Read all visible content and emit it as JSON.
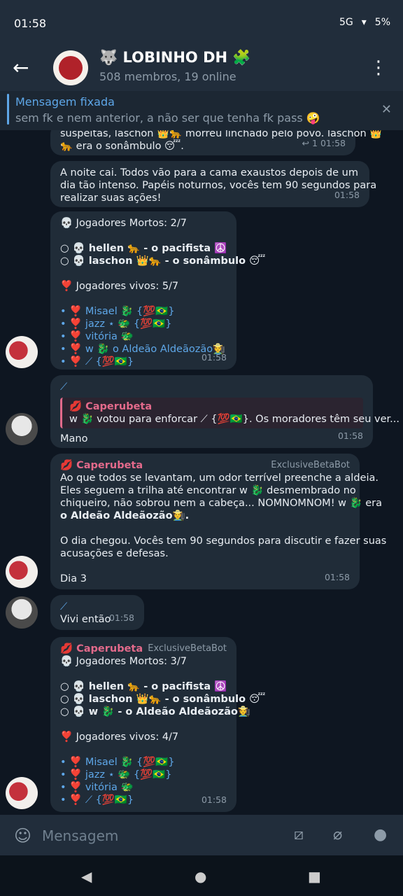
{
  "status": {
    "time": "01:58",
    "battery": "5%",
    "network": "5G"
  },
  "header": {
    "title": "🐺 LOBINHO DH 🧩",
    "subtitle": "508 membros, 19 online"
  },
  "pinned": {
    "label": "Mensagem fixada",
    "text": "sem fk e nem anterior, a não ser que tenha fk pass 🤪"
  },
  "messages": {
    "m1": {
      "l1": "suspeitas, laschon 👑🐆 morreu linchado pelo povo. laschon 👑",
      "l2": "🐆 era o sonâmbulo 😴.",
      "meta": "↩ 1 01:58"
    },
    "m2": {
      "l1": "A noite cai. Todos vão para a cama exaustos depois de um",
      "l2": "dia tão intenso. Papéis noturnos, vocês tem 90 segundos para",
      "l3": "realizar suas ações!",
      "time": "01:58"
    },
    "m3": {
      "h1": "💀 Jogadores Mortos: 2/7",
      "d1": "○ 💀 hellen 🐆 - o pacifista ☮️",
      "d2": "○ 💀 laschon 👑🐆 - o sonâmbulo 😴",
      "h2": "❣️ Jogadores vivos: 5/7",
      "a1": "• ❣️ Misael 🐉 {💯🇧🇷}",
      "a2": "• ❣️ jazz ⋆ 🐲 {💯🇧🇷}",
      "a3": "• ❣️ vitória 🐲",
      "a4": "• ❣️ w 🐉 o Aldeão Aldeãozão🧑‍🌾",
      "a5": "• ❣️ ⟋ {💯🇧🇷}",
      "time": "01:58"
    },
    "m4": {
      "top": "⟋",
      "q_sender": "💋 Caperubeta",
      "q_text": "w 🐉 votou para enforcar ⟋ {💯🇧🇷}.  Os moradores têm seu ver...",
      "text": "Mano",
      "time": "01:58"
    },
    "m5": {
      "sender": "💋 Caperubeta",
      "via": "ExclusiveBetaBot",
      "l1": "Ao que todos se levantam, um odor terrível preenche a aldeia.",
      "l2": "Eles seguem a trilha até encontrar w 🐉 desmembrado no",
      "l3": "chiqueiro, não sobrou nem a cabeça... NOMNOMNOM! w 🐉 era",
      "l4": "o Aldeão Aldeãozão🧑‍🌾.",
      "l5": "O dia chegou. Vocês tem 90 segundos para discutir e fazer suas",
      "l6": "acusações e defesas.",
      "l7": "Dia 3",
      "time": "01:58"
    },
    "m6": {
      "top": "⟋",
      "text": "Vivi então",
      "time": "01:58"
    },
    "m7": {
      "sender": "💋 Caperubeta",
      "via": "ExclusiveBetaBot",
      "h1": "💀 Jogadores Mortos: 3/7",
      "d1": "○ 💀 hellen 🐆 - o pacifista ☮️",
      "d2": "○ 💀 laschon 👑🐆 - o sonâmbulo 😴",
      "d3": "○ 💀 w 🐉 - o Aldeão Aldeãozão🧑‍🌾",
      "h2": "❣️ Jogadores vivos: 4/7",
      "a1": "• ❣️ Misael 🐉 {💯🇧🇷}",
      "a2": "• ❣️ jazz ⋆ 🐲 {💯🇧🇷}",
      "a3": "• ❣️ vitória 🐲",
      "a4": "• ❣️ ⟋ {💯🇧🇷}",
      "time": "01:58"
    }
  },
  "input": {
    "placeholder": "Mensagem"
  }
}
